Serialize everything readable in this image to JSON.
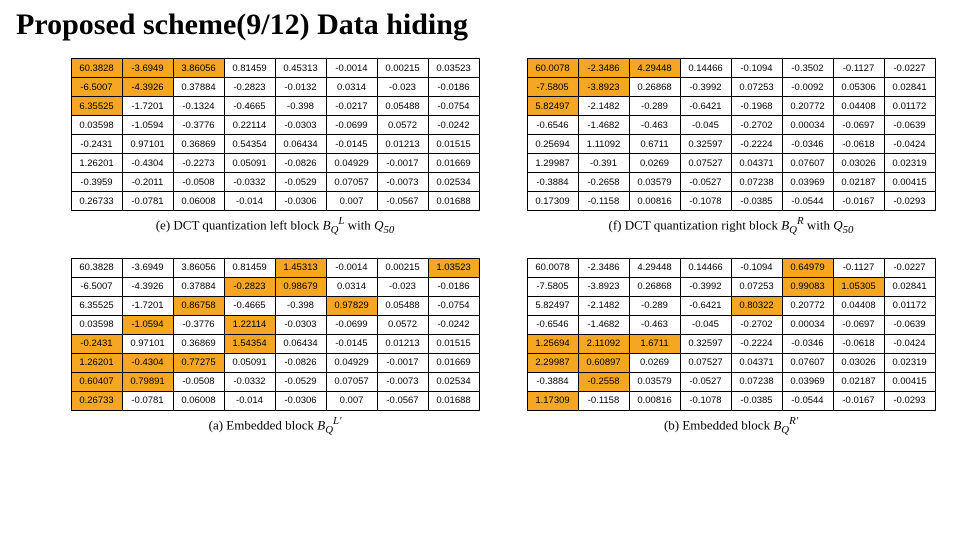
{
  "title": "Proposed scheme(9/12) Data hiding",
  "chart_data": [
    {
      "type": "table",
      "label": "(e) DCT quantization left block B_Q^L with Q_50",
      "cells": [
        [
          "60.3828",
          "-3.6949",
          "3.86056",
          "0.81459",
          "0.45313",
          "-0.0014",
          "0.00215",
          "0.03523"
        ],
        [
          "-6.5007",
          "-4.3926",
          "0.37884",
          "-0.2823",
          "-0.0132",
          "0.0314",
          "-0.023",
          "-0.0186"
        ],
        [
          "6.35525",
          "-1.7201",
          "-0.1324",
          "-0.4665",
          "-0.398",
          "-0.0217",
          "0.05488",
          "-0.0754"
        ],
        [
          "0.03598",
          "-1.0594",
          "-0.3776",
          "0.22114",
          "-0.0303",
          "-0.0699",
          "0.0572",
          "-0.0242"
        ],
        [
          "-0.2431",
          "0.97101",
          "0.36869",
          "0.54354",
          "0.06434",
          "-0.0145",
          "0.01213",
          "0.01515"
        ],
        [
          "1.26201",
          "-0.4304",
          "-0.2273",
          "0.05091",
          "-0.0826",
          "0.04929",
          "-0.0017",
          "0.01669"
        ],
        [
          "-0.3959",
          "-0.2011",
          "-0.0508",
          "-0.0332",
          "-0.0529",
          "0.07057",
          "-0.0073",
          "0.02534"
        ],
        [
          "0.26733",
          "-0.0781",
          "0.06008",
          "-0.014",
          "-0.0306",
          "0.007",
          "-0.0567",
          "0.01688"
        ]
      ],
      "highlight": [
        [
          0,
          0
        ],
        [
          0,
          1
        ],
        [
          0,
          2
        ],
        [
          1,
          0
        ],
        [
          1,
          1
        ],
        [
          2,
          0
        ]
      ]
    },
    {
      "type": "table",
      "label": "(f) DCT quantization right block B_Q^R with Q_50",
      "cells": [
        [
          "60.0078",
          "-2.3486",
          "4.29448",
          "0.14466",
          "-0.1094",
          "-0.3502",
          "-0.1127",
          "-0.0227"
        ],
        [
          "-7.5805",
          "-3.8923",
          "0.26868",
          "-0.3992",
          "0.07253",
          "-0.0092",
          "0.05306",
          "0.02841"
        ],
        [
          "5.82497",
          "-2.1482",
          "-0.289",
          "-0.6421",
          "-0.1968",
          "0.20772",
          "0.04408",
          "0.01172"
        ],
        [
          "-0.6546",
          "-1.4682",
          "-0.463",
          "-0.045",
          "-0.2702",
          "0.00034",
          "-0.0697",
          "-0.0639"
        ],
        [
          "0.25694",
          "1.11092",
          "0.6711",
          "0.32597",
          "-0.2224",
          "-0.0346",
          "-0.0618",
          "-0.0424"
        ],
        [
          "1.29987",
          "-0.391",
          "0.0269",
          "0.07527",
          "0.04371",
          "0.07607",
          "0.03026",
          "0.02319"
        ],
        [
          "-0.3884",
          "-0.2658",
          "0.03579",
          "-0.0527",
          "0.07238",
          "0.03969",
          "0.02187",
          "0.00415"
        ],
        [
          "0.17309",
          "-0.1158",
          "0.00816",
          "-0.1078",
          "-0.0385",
          "-0.0544",
          "-0.0167",
          "-0.0293"
        ]
      ],
      "highlight": [
        [
          0,
          0
        ],
        [
          0,
          1
        ],
        [
          0,
          2
        ],
        [
          1,
          0
        ],
        [
          1,
          1
        ],
        [
          2,
          0
        ]
      ]
    },
    {
      "type": "table",
      "label": "(a) Embedded block B_Q^{L'}",
      "cells": [
        [
          "60.3828",
          "-3.6949",
          "3.86056",
          "0.81459",
          "1.45313",
          "-0.0014",
          "0.00215",
          "1.03523"
        ],
        [
          "-6.5007",
          "-4.3926",
          "0.37884",
          "-0.2823",
          "0.98679",
          "0.0314",
          "-0.023",
          "-0.0186"
        ],
        [
          "6.35525",
          "-1.7201",
          "0.86758",
          "-0.4665",
          "-0.398",
          "0.97829",
          "0.05488",
          "-0.0754"
        ],
        [
          "0.03598",
          "-1.0594",
          "-0.3776",
          "1.22114",
          "-0.0303",
          "-0.0699",
          "0.0572",
          "-0.0242"
        ],
        [
          "-0.2431",
          "0.97101",
          "0.36869",
          "1.54354",
          "0.06434",
          "-0.0145",
          "0.01213",
          "0.01515"
        ],
        [
          "1.26201",
          "-0.4304",
          "0.77275",
          "0.05091",
          "-0.0826",
          "0.04929",
          "-0.0017",
          "0.01669"
        ],
        [
          "0.60407",
          "0.79891",
          "-0.0508",
          "-0.0332",
          "-0.0529",
          "0.07057",
          "-0.0073",
          "0.02534"
        ],
        [
          "0.26733",
          "-0.0781",
          "0.06008",
          "-0.014",
          "-0.0306",
          "0.007",
          "-0.0567",
          "0.01688"
        ]
      ],
      "highlight": [
        [
          0,
          4
        ],
        [
          0,
          7
        ],
        [
          1,
          3
        ],
        [
          1,
          4
        ],
        [
          2,
          2
        ],
        [
          2,
          5
        ],
        [
          3,
          1
        ],
        [
          3,
          3
        ],
        [
          4,
          0
        ],
        [
          4,
          3
        ],
        [
          5,
          0
        ],
        [
          5,
          1
        ],
        [
          5,
          2
        ],
        [
          6,
          0
        ],
        [
          6,
          1
        ],
        [
          7,
          0
        ]
      ]
    },
    {
      "type": "table",
      "label": "(b) Embedded block B_Q^{R'}",
      "cells": [
        [
          "60.0078",
          "-2.3486",
          "4.29448",
          "0.14466",
          "-0.1094",
          "0.64979",
          "-0.1127",
          "-0.0227"
        ],
        [
          "-7.5805",
          "-3.8923",
          "0.26868",
          "-0.3992",
          "0.07253",
          "0.99083",
          "1.05305",
          "0.02841"
        ],
        [
          "5.82497",
          "-2.1482",
          "-0.289",
          "-0.6421",
          "0.80322",
          "0.20772",
          "0.04408",
          "0.01172"
        ],
        [
          "-0.6546",
          "-1.4682",
          "-0.463",
          "-0.045",
          "-0.2702",
          "0.00034",
          "-0.0697",
          "-0.0639"
        ],
        [
          "1.25694",
          "2.11092",
          "1.6711",
          "0.32597",
          "-0.2224",
          "-0.0346",
          "-0.0618",
          "-0.0424"
        ],
        [
          "2.29987",
          "0.60897",
          "0.0269",
          "0.07527",
          "0.04371",
          "0.07607",
          "0.03026",
          "0.02319"
        ],
        [
          "-0.3884",
          "-0.2558",
          "0.03579",
          "-0.0527",
          "0.07238",
          "0.03969",
          "0.02187",
          "0.00415"
        ],
        [
          "1.17309",
          "-0.1158",
          "0.00816",
          "-0.1078",
          "-0.0385",
          "-0.0544",
          "-0.0167",
          "-0.0293"
        ]
      ],
      "highlight": [
        [
          0,
          5
        ],
        [
          1,
          5
        ],
        [
          1,
          6
        ],
        [
          2,
          4
        ],
        [
          4,
          0
        ],
        [
          4,
          1
        ],
        [
          4,
          2
        ],
        [
          5,
          0
        ],
        [
          5,
          1
        ],
        [
          6,
          1
        ],
        [
          7,
          0
        ]
      ]
    }
  ],
  "captions": {
    "e_pre": "(e) DCT quantization left block ",
    "f_pre": "(f) DCT quantization right block ",
    "q_with": " with ",
    "a_pre": "(a) Embedded block ",
    "b_pre": "(b) Embedded block "
  }
}
